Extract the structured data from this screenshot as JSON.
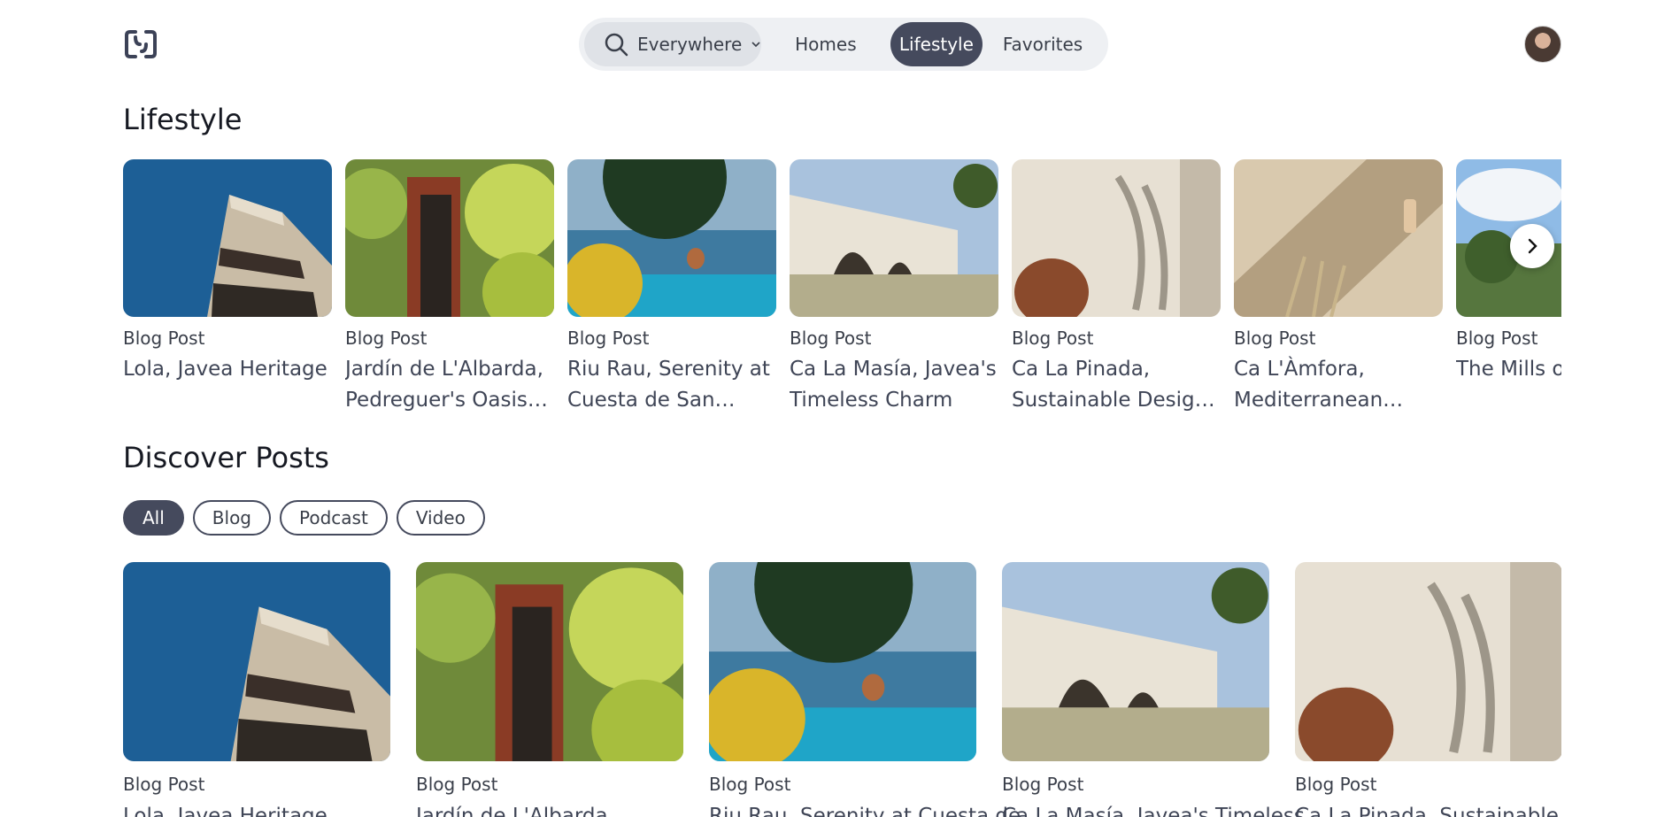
{
  "header": {
    "search_label": "Everywhere",
    "tabs": [
      {
        "label": "Homes",
        "active": false
      },
      {
        "label": "Lifestyle",
        "active": true
      },
      {
        "label": "Favorites",
        "active": false
      }
    ]
  },
  "lifestyle": {
    "title": "Lifestyle",
    "items": [
      {
        "type": "Blog Post",
        "title": "Lola, Javea Heritage",
        "image": "building-blue-sky"
      },
      {
        "type": "Blog Post",
        "title": "Jardín de L'Albarda, Pedreguer's Oasis of Tranquility",
        "image": "garden-doorway"
      },
      {
        "type": "Blog Post",
        "title": "Riu Rau, Serenity at Cuesta de San Antonio",
        "image": "pool-sea-view"
      },
      {
        "type": "Blog Post",
        "title": "Ca La Masía, Javea's Timeless Charm",
        "image": "white-villa-arches"
      },
      {
        "type": "Blog Post",
        "title": "Ca La Pinada, Sustainable Design in Javea",
        "image": "clay-pot-shadow"
      },
      {
        "type": "Blog Post",
        "title": "Ca L'Àmfora, Mediterranean Palace in Javea",
        "image": "wall-lamp-grass"
      },
      {
        "type": "Blog Post",
        "title": "The Mills of Javea",
        "image": "hills-clouds"
      }
    ]
  },
  "discover": {
    "title": "Discover Posts",
    "filters": [
      {
        "label": "All",
        "active": true
      },
      {
        "label": "Blog",
        "active": false
      },
      {
        "label": "Podcast",
        "active": false
      },
      {
        "label": "Video",
        "active": false
      }
    ],
    "items": [
      {
        "type": "Blog Post",
        "title": "Lola, Javea Heritage"
      },
      {
        "type": "Blog Post",
        "title": "Jardín de L'Albarda,"
      },
      {
        "type": "Blog Post",
        "title": "Riu Rau, Serenity at Cuesta de"
      },
      {
        "type": "Blog Post",
        "title": "Ca La Masía, Javea's Timeless"
      },
      {
        "type": "Blog Post",
        "title": "Ca La Pinada, Sustainable"
      }
    ]
  },
  "icons": {
    "search": "search-icon",
    "dropdown": "chevron-down-icon",
    "next": "chevron-right-icon"
  },
  "colors": {
    "accent": "#454a5d",
    "nav_bg": "#eef0f3"
  }
}
